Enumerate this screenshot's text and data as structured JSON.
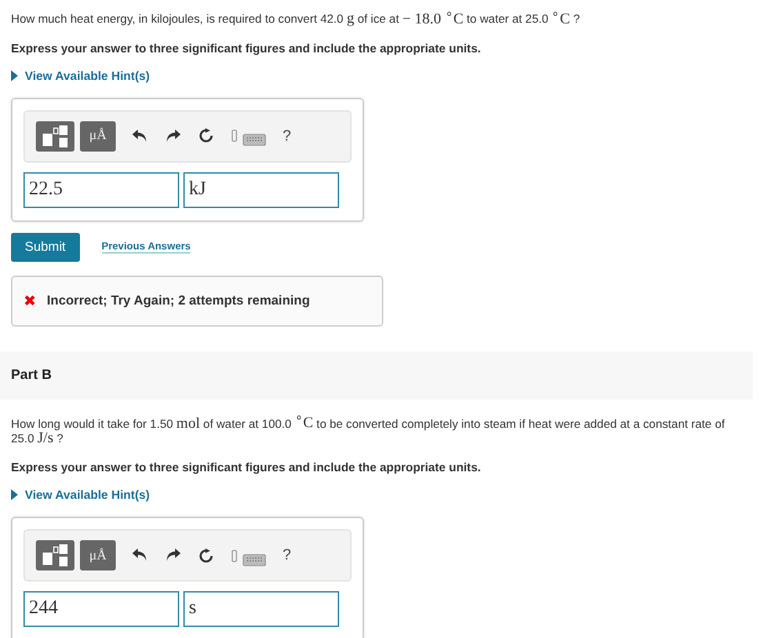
{
  "parts": [
    {
      "question": [
        {
          "kind": "text",
          "text": "How much heat energy, in kilojoules, is required to convert 42.0 "
        },
        {
          "kind": "math",
          "text": "g"
        },
        {
          "kind": "text",
          "text": " of ice at "
        },
        {
          "kind": "math",
          "text": "− 18.0 $^{∘}$C"
        },
        {
          "kind": "text",
          "text": " to water at  25.0 "
        },
        {
          "kind": "math",
          "text": "$^{∘}$C"
        },
        {
          "kind": "text",
          "text": " ?"
        }
      ],
      "instruction": "Express your answer to three significant figures and include the appropriate units.",
      "hint_link": "View Available Hint(s)",
      "toolbar": {
        "symbols_button": "μÅ",
        "help": "?"
      },
      "answer": {
        "value": "22.5",
        "units": "kJ"
      },
      "submit": "Submit",
      "previous": "Previous Answers",
      "feedback": {
        "kind": "incorrect",
        "icon": "✖",
        "text": "Incorrect; Try Again; 2 attempts remaining"
      }
    },
    {
      "title": "Part B",
      "question": [
        {
          "kind": "text",
          "text": "How long would it take for 1.50 "
        },
        {
          "kind": "math",
          "text": "mol"
        },
        {
          "kind": "text",
          "text": " of water at 100.0 "
        },
        {
          "kind": "math",
          "text": "$^{∘}$C"
        },
        {
          "kind": "text",
          "text": " to be converted completely into steam if heat were added at a constant rate of 25.0 "
        },
        {
          "kind": "math",
          "text": "J/s"
        },
        {
          "kind": "text",
          "text": " ?"
        }
      ],
      "instruction": "Express your answer to three significant figures and include the appropriate units.",
      "hint_link": "View Available Hint(s)",
      "toolbar": {
        "symbols_button": "μÅ",
        "help": "?"
      },
      "answer": {
        "value": "244",
        "units": "s"
      }
    }
  ]
}
